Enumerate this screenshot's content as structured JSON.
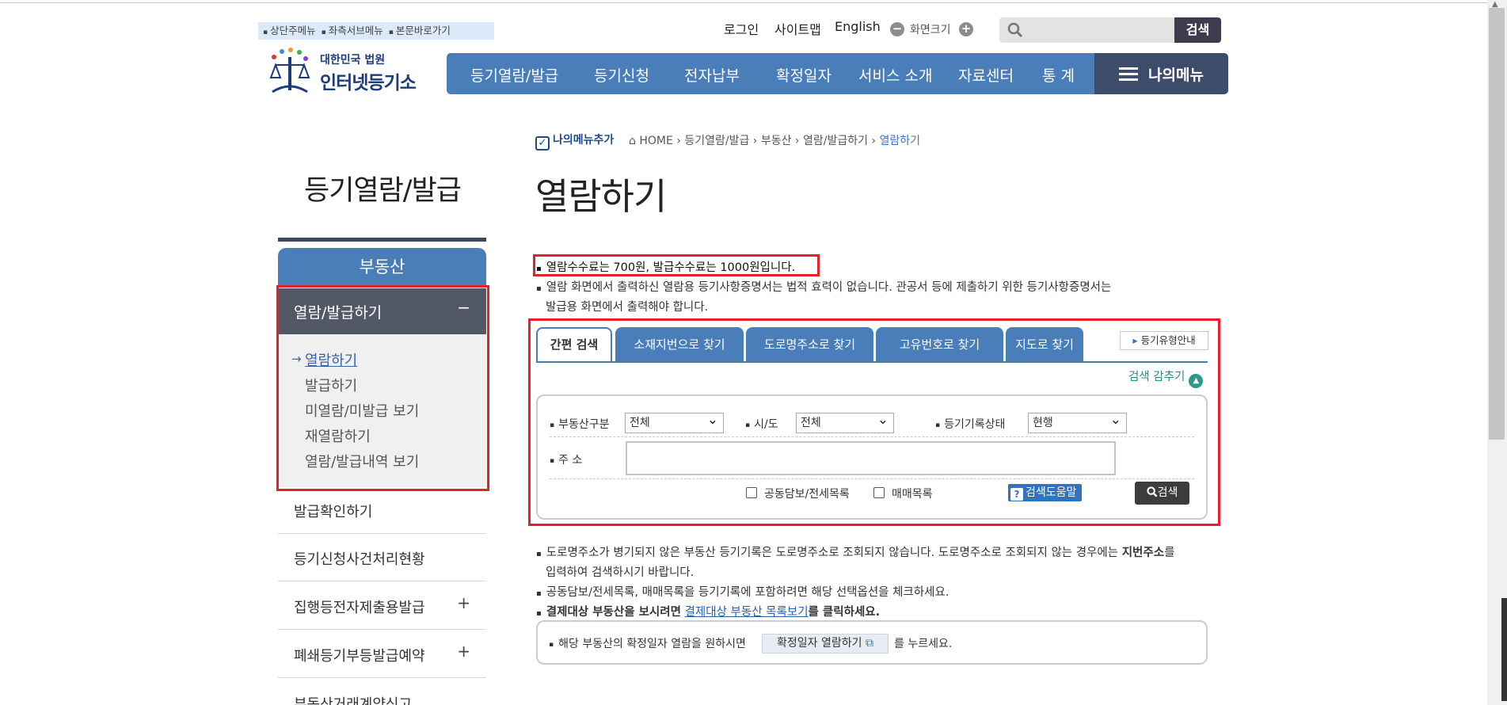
{
  "skip_links": [
    "상단주메뉴",
    "좌측서브메뉴",
    "본문바로가기"
  ],
  "logo": {
    "line1": "대한민국 법원",
    "line2": "인터넷등기소"
  },
  "util": {
    "login": "로그인",
    "sitemap": "사이트맵",
    "english": "English",
    "screen_size": "화면크기",
    "minus": "−",
    "plus": "+"
  },
  "top_search": {
    "placeholder": "",
    "button": "검색"
  },
  "gnb": [
    "등기열람/발급",
    "등기신청",
    "전자납부",
    "확정일자",
    "서비스 소개",
    "자료센터",
    "통 계"
  ],
  "mymenu": "나의메뉴",
  "side": {
    "title": "등기열람/발급",
    "head": "부동산",
    "active": "열람/발급하기",
    "active_toggle": "−",
    "sub": [
      "열람하기",
      "발급하기",
      "미열람/미발급 보기",
      "재열람하기",
      "열람/발급내역 보기"
    ],
    "items": [
      "발급확인하기",
      "등기신청사건처리현황",
      "집행등전자제출용발급",
      "폐쇄등기부등발급예약",
      "부동산거래계약신고"
    ]
  },
  "breadcrumb": {
    "add_mymenu": "나의메뉴추가",
    "home": "HOME",
    "p1": "등기열람/발급",
    "p2": "부동산",
    "p3": "열람/발급하기",
    "current": "열람하기"
  },
  "page_title": "열람하기",
  "notices_top": {
    "n1": "열람수수료는 700원, 발급수수료는 1000원입니다.",
    "n2a": "열람 화면에서 출력하신 열람용 등기사항증명서는 법적 효력이 없습니다. 관공서 등에 제출하기 위한 등기사항증명서는",
    "n2b": "발급용 화면에서 출력해야 합니다."
  },
  "tabs": [
    "간편 검색",
    "소재지번으로 찾기",
    "도로명주소로 찾기",
    "고유번호로 찾기",
    "지도로 찾기"
  ],
  "type_guide": "등기유형안내",
  "search_hide": "검색 감추기",
  "form": {
    "type_label": "부동산구분",
    "type_value": "전체",
    "sido_label": "시/도",
    "sido_value": "전체",
    "status_label": "등기기록상태",
    "status_value": "현행",
    "addr_label": "주 소",
    "addr_value": "",
    "chk1": "공동담보/전세목록",
    "chk2": "매매목록",
    "help": "검색도움말",
    "search": "검색"
  },
  "notices_bottom": {
    "b1a": "도로명주소가 병기되지 않은 부동산 등기기록은 도로명주소로 조회되지 않습니다. 도로명주소로 조회되지 않는 경우에는",
    "b1bold": "지번주소",
    "b1c": "를",
    "b1d": "입력하여 검색하시기 바랍니다.",
    "b2": "공동담보/전세목록, 매매목록을 등기기록에 포함하려면 해당 선택옵션을 체크하세요.",
    "b3a": "결제대상 부동산을 보시려면",
    "b3link": "결제대상 부동산 목록보기",
    "b3b": "를 클릭하세요."
  },
  "confirm": {
    "t1": "해당 부동산의 확정일자 열람을 원하시면",
    "btn": "확정일자 열람하기",
    "t2": "를 누르세요."
  },
  "colors": {
    "primary": "#4a7eb9",
    "dark": "#3c4c6a",
    "highlight": "#e8202c"
  }
}
